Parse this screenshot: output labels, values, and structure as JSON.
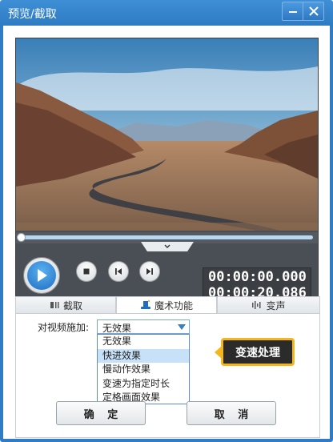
{
  "window": {
    "title": "预览/截取"
  },
  "titlebar": {
    "minimize_icon": "minimize-icon",
    "close_icon": "close-icon"
  },
  "player": {
    "time_current": "00:00:00.000",
    "time_total": "00:00:20.086",
    "progress_fraction": 0,
    "volume_fraction": 1.0
  },
  "tabs": [
    {
      "label": "截取",
      "icon": "crop-icon",
      "active": false
    },
    {
      "label": "魔术功能",
      "icon": "magic-hat-icon",
      "active": true
    },
    {
      "label": "变声",
      "icon": "waveform-icon",
      "active": false
    }
  ],
  "effects": {
    "apply_label": "对视频施加:",
    "selected_value": "无效果",
    "options": [
      "无效果",
      "快进效果",
      "慢动作效果",
      "变速为指定时长",
      "定格画面效果"
    ],
    "highlighted_index": 1
  },
  "callout": {
    "text": "变速处理",
    "accent": "#f3b61b"
  },
  "footer": {
    "ok_label": "确 定",
    "cancel_label": "取 消"
  },
  "colors": {
    "title_bar": "#2f7cc4",
    "accent_blue": "#1e8ae6"
  }
}
